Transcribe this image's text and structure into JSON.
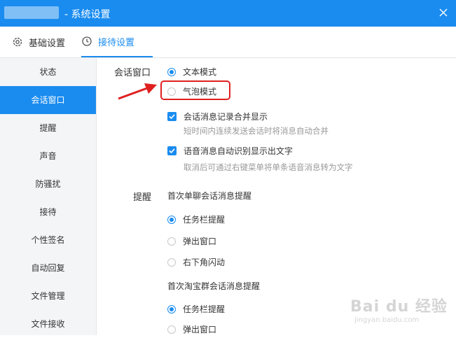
{
  "window": {
    "title": "- 系统设置"
  },
  "tabs": [
    {
      "label": "基础设置",
      "icon": "gear-icon"
    },
    {
      "label": "接待设置",
      "icon": "clock-icon",
      "active": true
    }
  ],
  "sidebar": {
    "items": [
      {
        "label": "状态"
      },
      {
        "label": "会话窗口",
        "active": true
      },
      {
        "label": "提醒"
      },
      {
        "label": "声音"
      },
      {
        "label": "防骚扰"
      },
      {
        "label": "接待"
      },
      {
        "label": "个性签名"
      },
      {
        "label": "自动回复"
      },
      {
        "label": "文件管理"
      },
      {
        "label": "文件接收"
      }
    ]
  },
  "session_window": {
    "label": "会话窗口",
    "options": [
      {
        "label": "文本模式",
        "selected": true
      },
      {
        "label": "气泡模式",
        "selected": false
      }
    ],
    "merge_records": {
      "label": "会话消息记录合并显示",
      "checked": true,
      "hint": "短时间内连续发送会话时将消息自动合并"
    },
    "voice_to_text": {
      "label": "语音消息自动识别显示出文字",
      "checked": true,
      "hint": "取消后可通过右键菜单将单条语音消息转为文字"
    }
  },
  "reminder": {
    "label": "提醒",
    "single_chat": {
      "title": "首次单聊会话消息提醒",
      "options": [
        {
          "label": "任务栏提醒",
          "selected": true
        },
        {
          "label": "弹出窗口",
          "selected": false
        },
        {
          "label": "右下角闪动",
          "selected": false
        }
      ]
    },
    "group_chat": {
      "title": "首次淘宝群会话消息提醒",
      "options": [
        {
          "label": "任务栏提醒",
          "selected": true
        },
        {
          "label": "弹出窗口",
          "selected": false
        }
      ]
    }
  },
  "watermark": {
    "main": "Bai du 经验",
    "sub": "jingyan.baidu.com"
  },
  "colors": {
    "accent": "#1a8cf0",
    "annotation": "#e02020"
  }
}
